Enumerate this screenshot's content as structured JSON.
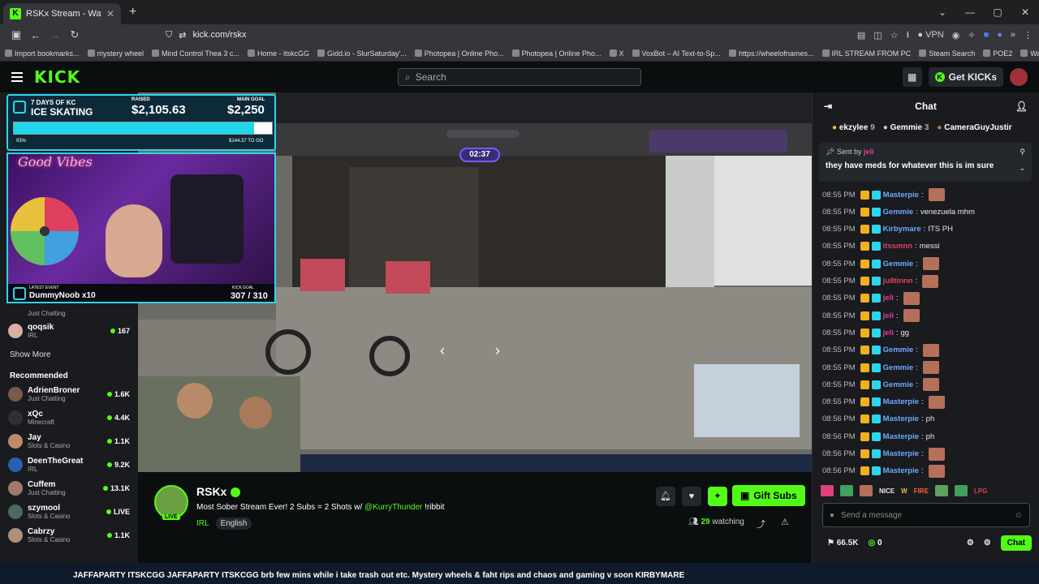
{
  "browser": {
    "tab_title": "RSKx Stream - Watch Live o",
    "url": "kick.com/rskx",
    "vpn_label": "VPN",
    "bookmarks": [
      "Import bookmarks...",
      "mystery wheel",
      "Mind Control Thea 3 c...",
      "Home - itskcGG",
      "Gidd.io - SlurSaturday'...",
      "Photopea | Online Pho...",
      "Photopea | Online Pho...",
      "X",
      "VoxBot – AI Text-to-Sp...",
      "https://wheelofnames...",
      "IRL STREAM FROM PC",
      "Steam Search",
      "POE2",
      "Watch Supernatural - ..."
    ]
  },
  "header": {
    "logo": "KICK",
    "search_placeholder": "Search",
    "get_kicks": "Get KICKs"
  },
  "sidebar": {
    "followed_partial": [
      {
        "name": "",
        "category": "Just Chatting",
        "viewers": ""
      },
      {
        "name": "qoqsik",
        "category": "IRL",
        "viewers": "167"
      }
    ],
    "show_more": "Show More",
    "recommended_title": "Recommended",
    "recommended": [
      {
        "name": "AdrienBroner",
        "category": "Just Chatting",
        "viewers": "1.6K"
      },
      {
        "name": "xQc",
        "category": "Minecraft",
        "viewers": "4.4K"
      },
      {
        "name": "Jay",
        "category": "Slots & Casino",
        "viewers": "1.1K"
      },
      {
        "name": "DeenTheGreat",
        "category": "IRL",
        "viewers": "9.2K"
      },
      {
        "name": "Cuffem",
        "category": "Just Chatting",
        "viewers": "13.1K"
      },
      {
        "name": "szymool",
        "category": "Slots & Casino",
        "viewers": "LIVE"
      },
      {
        "name": "Cabrzy",
        "category": "Slots & Casino",
        "viewers": "1.1K"
      }
    ]
  },
  "overlay": {
    "goal_title_1": "7 DAYS OF KC",
    "goal_title_2": "ICE SKATING",
    "raised_label": "RAISED",
    "raised": "$2,105.63",
    "main_goal_label": "MAIN GOAL",
    "main_goal": "$2,250",
    "percent": "93%",
    "progress_fraction": 0.93,
    "remaining": "$144.37 TO GO",
    "neon_sign": "Good Vibes",
    "latest_event_label": "LATEST EVENT",
    "latest_event": "DummyNoob x10",
    "kick_goal_label": "KICK GOAL",
    "kick_goal": "307 / 310",
    "timer": "02:37"
  },
  "stream": {
    "channel": "RSKx",
    "live_badge": "LIVE",
    "title_prefix": "Most Sober Stream Ever! 2 Subs = 2 Shots w/ ",
    "title_mention": "@KurryThunder",
    "title_suffix": " !ribbit",
    "category": "IRL",
    "language": "English",
    "gift_subs": "Gift Subs",
    "watching_count": "29",
    "watching_label": "watching"
  },
  "chat": {
    "title": "Chat",
    "gifters": [
      {
        "name": "ekzylee",
        "count": "9"
      },
      {
        "name": "Gemmie",
        "count": "3"
      },
      {
        "name": "CameraGuyJustir",
        "count": ""
      }
    ],
    "pinned_by_label": "Sent by",
    "pinned_user": "jeli",
    "pinned_text": "they have meds for whatever this is im sure",
    "messages": [
      {
        "time": "08:55 PM",
        "user": "Masterpie",
        "text": "",
        "color": "#6fa8ff",
        "emote": true
      },
      {
        "time": "08:55 PM",
        "user": "Gemmie",
        "text": "venezuela mhm",
        "color": "#6fa8ff",
        "emote": false
      },
      {
        "time": "08:55 PM",
        "user": "Kirbymare",
        "text": "ITS PH",
        "color": "#6fa8ff",
        "emote": false
      },
      {
        "time": "08:55 PM",
        "user": "itssmnn",
        "text": "messi",
        "color": "#e04060",
        "emote": false
      },
      {
        "time": "08:55 PM",
        "user": "Gemmie",
        "text": "",
        "color": "#6fa8ff",
        "emote": true
      },
      {
        "time": "08:55 PM",
        "user": "ju8tinnn",
        "text": "",
        "color": "#e04060",
        "emote": true
      },
      {
        "time": "08:55 PM",
        "user": "jeli",
        "text": "",
        "color": "#e04090",
        "emote": true
      },
      {
        "time": "08:55 PM",
        "user": "jeli",
        "text": "",
        "color": "#e04090",
        "emote": true
      },
      {
        "time": "08:55 PM",
        "user": "jeli",
        "text": "gg",
        "color": "#e04090",
        "emote": false
      },
      {
        "time": "08:55 PM",
        "user": "Gemmie",
        "text": "",
        "color": "#6fa8ff",
        "emote": true
      },
      {
        "time": "08:55 PM",
        "user": "Gemmie",
        "text": "",
        "color": "#6fa8ff",
        "emote": true
      },
      {
        "time": "08:55 PM",
        "user": "Gemmie",
        "text": "",
        "color": "#6fa8ff",
        "emote": true
      },
      {
        "time": "08:55 PM",
        "user": "Masterpie",
        "text": "",
        "color": "#6fa8ff",
        "emote": true
      },
      {
        "time": "08:56 PM",
        "user": "Masterpie",
        "text": "ph",
        "color": "#6fa8ff",
        "emote": false
      },
      {
        "time": "08:56 PM",
        "user": "Masterpie",
        "text": "ph",
        "color": "#6fa8ff",
        "emote": false
      },
      {
        "time": "08:56 PM",
        "user": "Masterpie",
        "text": "",
        "color": "#6fa8ff",
        "emote": true
      },
      {
        "time": "08:56 PM",
        "user": "Masterpie",
        "text": "",
        "color": "#6fa8ff",
        "emote": true
      }
    ],
    "emote_bar": [
      "NICE",
      "W",
      "FIRE",
      "LPG"
    ],
    "input_placeholder": "Send a message",
    "kicks_balance": "66.5K",
    "points": "0",
    "chat_button": "Chat"
  },
  "ticker": {
    "text": "JAFFAPARTY ITSKCGG JAFFAPARTY ITSKCGG brb few mins while i take trash out etc. Mystery wheels & faht rips and chaos and gaming v soon KIRBYMARE"
  },
  "colors": {
    "accent": "#53fc18",
    "overlay_cyan": "#2dd5ea"
  }
}
